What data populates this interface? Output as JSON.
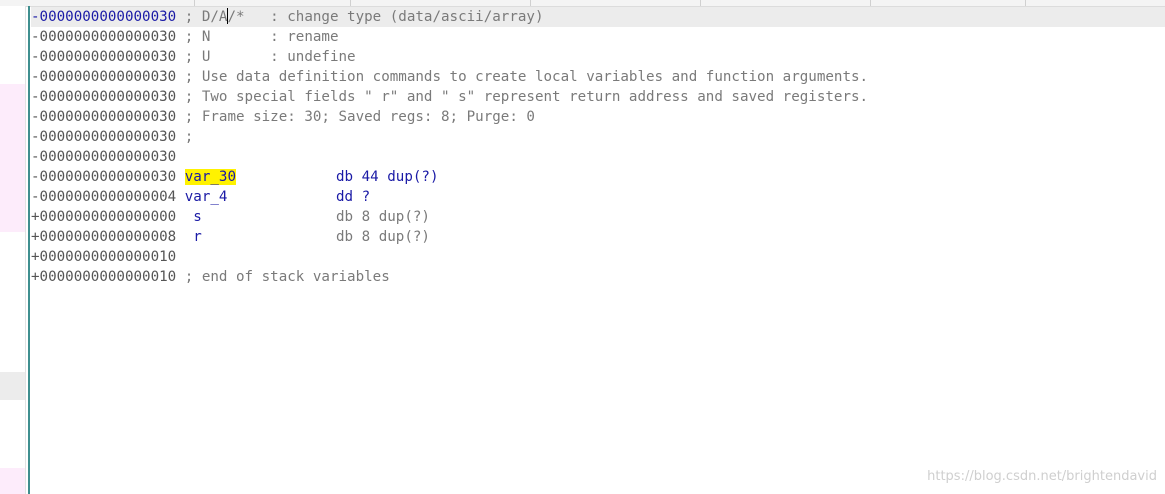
{
  "lines": [
    {
      "addr": "-0000000000000030",
      "text_a": " ; D/A",
      "text_b": "/*   : change type (data/ascii/array)"
    },
    {
      "addr": "-0000000000000030",
      "text": " ; N       : rename"
    },
    {
      "addr": "-0000000000000030",
      "text": " ; U       : undefine"
    },
    {
      "addr": "-0000000000000030",
      "text": " ; Use data definition commands to create local variables and function arguments."
    },
    {
      "addr": "-0000000000000030",
      "text": " ; Two special fields \" r\" and \" s\" represent return address and saved registers."
    },
    {
      "addr": "-0000000000000030",
      "text": " ; Frame size: 30; Saved regs: 8; Purge: 0"
    },
    {
      "addr": "-0000000000000030",
      "text": " ;"
    },
    {
      "addr": "-0000000000000030",
      "text": ""
    },
    {
      "addr": "-0000000000000030",
      "name": "var_30",
      "instr": "db 44 dup(?)"
    },
    {
      "addr": "-0000000000000004",
      "name": "var_4",
      "instr": "dd ?"
    },
    {
      "addr": "+0000000000000000",
      "name": " s",
      "instr": "db 8 dup(?)"
    },
    {
      "addr": "+0000000000000008",
      "name": " r",
      "instr": "db 8 dup(?)"
    },
    {
      "addr": "+0000000000000010",
      "text": ""
    },
    {
      "addr": "+0000000000000010",
      "text": " ; end of stack variables"
    }
  ],
  "watermark": "https://blog.csdn.net/brightendavid",
  "colors": {
    "address_current": "#1a1aa6",
    "address": "#555555",
    "comment": "#7a7a7a",
    "name": "#1a1aa6",
    "highlight": "#fff200",
    "divider": "#3f8f8f"
  }
}
